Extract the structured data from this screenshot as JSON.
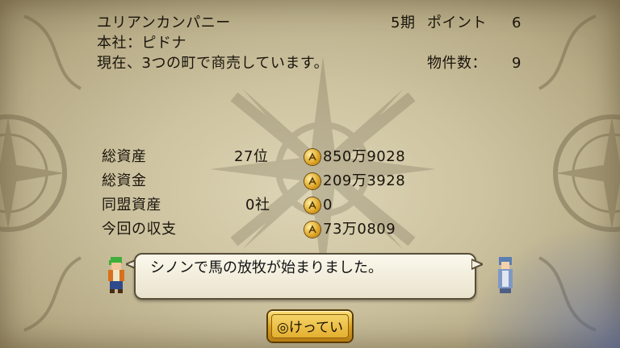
{
  "company": {
    "name": "ユリアンカンパニー",
    "hq": "本社：ピドナ",
    "status": "現在、3つの町で商売しています。"
  },
  "period": {
    "label": "5期",
    "points_label": "ポイント",
    "points_value": "6",
    "properties_label": "物件数：",
    "properties_value": "9"
  },
  "stats": [
    {
      "label": "総資産",
      "rank": "27位",
      "value": "850万9028"
    },
    {
      "label": "総資金",
      "rank": "",
      "value": "209万3928"
    },
    {
      "label": "同盟資産",
      "rank": "0社",
      "value": "0"
    },
    {
      "label": "今回の収支",
      "rank": "",
      "value": "73万0809"
    }
  ],
  "message": {
    "text": "シノンで馬の放牧が始まりました。"
  },
  "confirm_button": {
    "label": "◎けってい"
  },
  "icons": {
    "currency": "aurum-coin-icon",
    "left_character": "green-haired-merchant-portrait",
    "right_character": "blue-robed-woman-portrait"
  },
  "colors": {
    "parchment": "#cdc3a0",
    "text": "#1a140c",
    "button_gold": "#e3ae2d"
  }
}
